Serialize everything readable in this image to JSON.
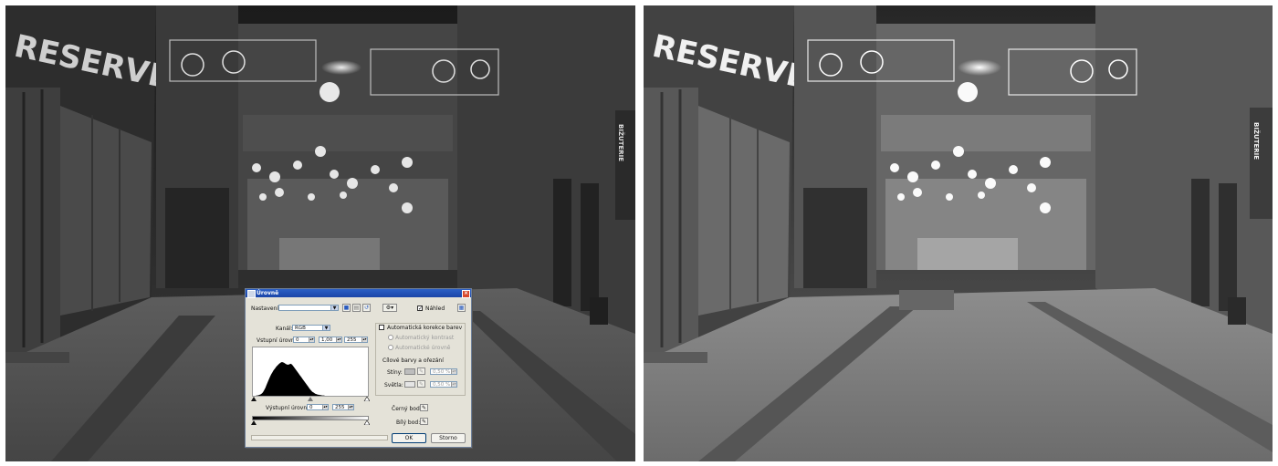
{
  "dialog": {
    "title": "Úrovně",
    "preset_label": "Nastavení:",
    "preset_value": "",
    "preview_label": "Náhled",
    "preview_checked": true,
    "channel_label": "Kanál:",
    "channel_value": "RGB",
    "input_levels_label": "Vstupní úrovně:",
    "input_black": "0",
    "input_gamma": "1,00",
    "input_white": "255",
    "output_levels_label": "Výstupní úrovně:",
    "output_black": "0",
    "output_white": "255",
    "auto_color_label": "Automatická korekce barev",
    "auto_color_checked": false,
    "auto_contrast_label": "Automatický kontrast",
    "auto_levels_label": "Automatické úrovně",
    "target_group_label": "Cílové barvy a ořezání",
    "shadows_label": "Stíny:",
    "shadows_value": "0,50 %",
    "highlights_label": "Světla:",
    "highlights_value": "0,50 %",
    "black_point_label": "Černý bod:",
    "white_point_label": "Bílý bod:",
    "ok_label": "OK",
    "cancel_label": "Storno",
    "histogram_bins": [
      0,
      0,
      1,
      1,
      2,
      3,
      4,
      6,
      9,
      13,
      18,
      24,
      31,
      38,
      45,
      52,
      58,
      64,
      69,
      74,
      78,
      82,
      86,
      89,
      92,
      95,
      97,
      99,
      100,
      99,
      98,
      96,
      94,
      93,
      92,
      93,
      94,
      95,
      93,
      90,
      86,
      82,
      78,
      74,
      70,
      66,
      62,
      58,
      54,
      50,
      46,
      42,
      38,
      34,
      30,
      26,
      22,
      18,
      15,
      12,
      10,
      8,
      6,
      5,
      4,
      3,
      3,
      2,
      2,
      1,
      1,
      1,
      0,
      0
    ]
  },
  "photo": {
    "left_sign": "RESERVED",
    "right_sign": "RESERVED",
    "left_vertical_sign": "BIŽUTERIE",
    "right_vertical_sign": "BIŽUTERIE"
  },
  "icons": {
    "save": "save-icon",
    "open": "open-icon",
    "reset": "reset-icon",
    "options": "options-icon",
    "eyedropper": "eyedropper-icon"
  }
}
